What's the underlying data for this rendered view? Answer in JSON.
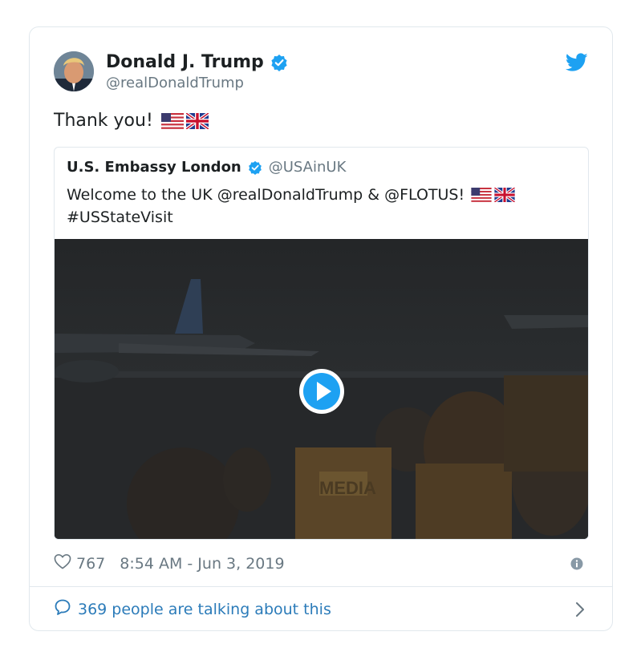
{
  "tweet": {
    "author_name": "Donald J. Trump",
    "author_handle": "@realDonaldTrump",
    "text": "Thank you!",
    "like_count": "767",
    "timestamp": "8:54 AM - Jun 3, 2019",
    "conversation": "369 people are talking about this"
  },
  "quoted_tweet": {
    "author_name": "U.S. Embassy London",
    "author_handle": "@USAinUK",
    "text_line1": "Welcome to the UK @realDonaldTrump & @FLOTUS!",
    "text_line2": "#USStateVisit",
    "media": "video"
  },
  "colors": {
    "verified": "#1da1f2",
    "link": "#2b7bb9",
    "muted": "#697882",
    "border": "#e1e8ed"
  },
  "icons": {
    "brand": "twitter-bird-icon",
    "like": "heart-icon",
    "info": "info-icon",
    "reply": "speech-bubble-icon",
    "more": "chevron-right-icon",
    "play": "play-icon"
  }
}
